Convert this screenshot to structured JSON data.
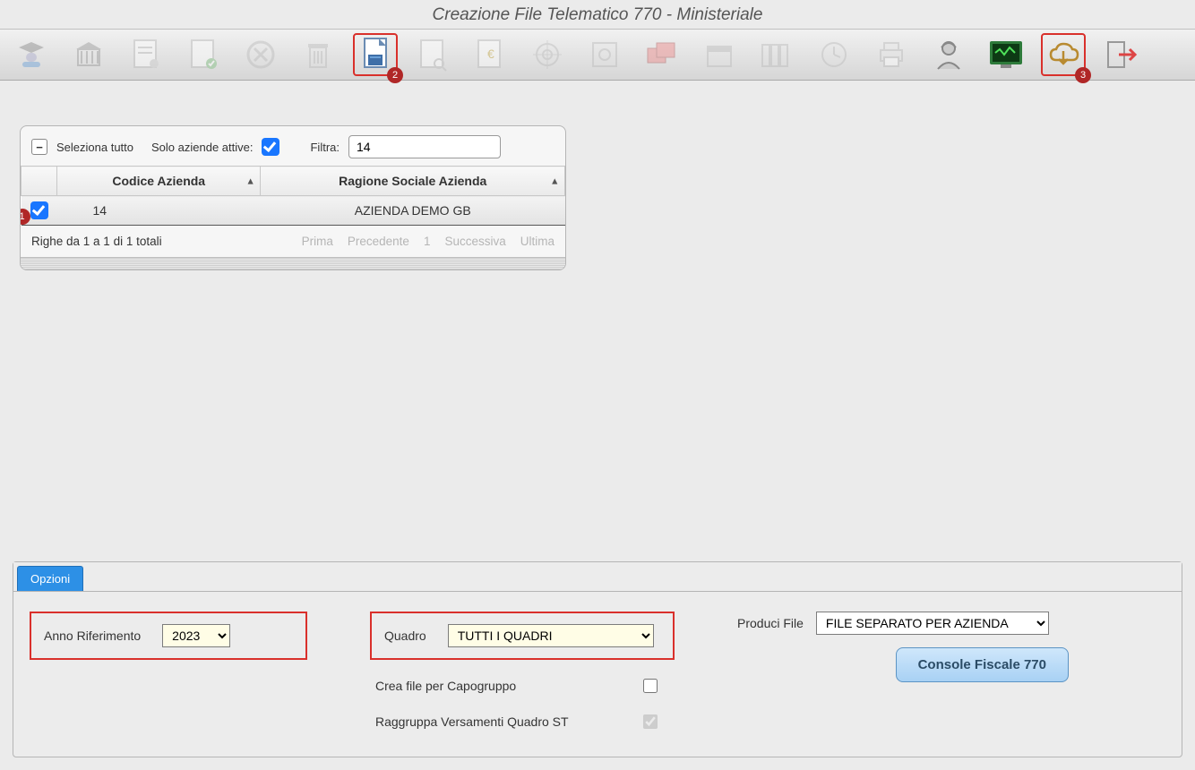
{
  "title": "Creazione File Telematico 770 - Ministeriale",
  "toolbar_callouts": {
    "file": "2",
    "cloud": "3"
  },
  "filter_bar": {
    "select_all_label": "Seleziona tutto",
    "only_active_label": "Solo aziende attive:",
    "filter_label": "Filtra:",
    "filter_value": "14"
  },
  "grid": {
    "columns": {
      "codice": "Codice Azienda",
      "ragione": "Ragione Sociale Azienda"
    },
    "rows": [
      {
        "checked": true,
        "codice": "14",
        "ragione": "AZIENDA DEMO GB"
      }
    ],
    "row_callout": "1",
    "summary": "Righe da 1 a 1 di 1 totali",
    "pager": {
      "first": "Prima",
      "prev": "Precedente",
      "page": "1",
      "next": "Successiva",
      "last": "Ultima"
    }
  },
  "tabs": {
    "options": "Opzioni"
  },
  "options": {
    "anno_label": "Anno Riferimento",
    "anno_value": "2023",
    "quadro_label": "Quadro",
    "quadro_value": "TUTTI I QUADRI",
    "crea_capogruppo": "Crea file per Capogruppo",
    "raggruppa_st": "Raggruppa Versamenti Quadro ST",
    "produci_label": "Produci File",
    "produci_value": "FILE SEPARATO PER AZIENDA",
    "console_btn": "Console Fiscale 770"
  }
}
